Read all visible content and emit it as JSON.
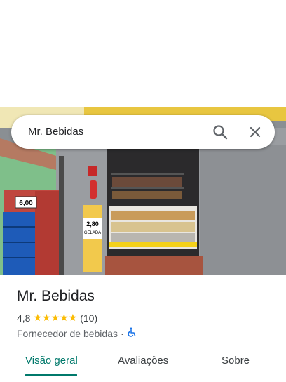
{
  "search": {
    "query": "Mr. Bebidas"
  },
  "photo": {
    "price_sign_1": "6,00",
    "price_sign_2": "2,80",
    "price_sign_2_sub": "GELADA"
  },
  "place": {
    "name": "Mr. Bebidas",
    "rating": "4,8",
    "stars": "★★★★★",
    "reviews": "(10)",
    "category": "Fornecedor de bebidas",
    "separator": "·",
    "accessibility_icon": "wheelchair-icon"
  },
  "tabs": [
    {
      "label": "Visão geral",
      "active": true
    },
    {
      "label": "Avaliações",
      "active": false
    },
    {
      "label": "Sobre",
      "active": false
    }
  ],
  "colors": {
    "accent": "#00796b",
    "stars": "#fbbc04",
    "access": "#1a73e8"
  }
}
